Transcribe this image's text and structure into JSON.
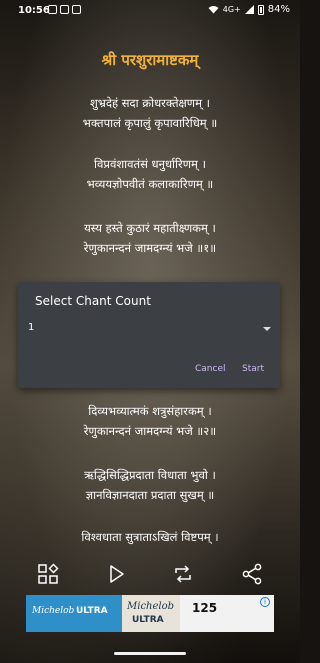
{
  "status_bar": {
    "time": "10:56",
    "network": "4G+",
    "battery": "84%"
  },
  "title": "श्री परशुरामाष्टकम्",
  "verses": [
    {
      "line1": "शुभ्रदेहं सदा क्रोधरक्तेक्षणम् ।",
      "line2": "भक्तपालं कृपालुं कृपावारिधिम् ॥"
    },
    {
      "line1": "विप्रवंशावतंसं धनुर्धारिणम् ।",
      "line2": "भव्ययज्ञोपवीतं कलाकारिणम् ॥"
    },
    {
      "line1": "यस्य हस्ते कुठारं महातीक्ष्णकम् ।",
      "line2": "रेणुकानन्दनं जामदग्न्यं भजे ॥१॥"
    },
    {
      "line1": "दिव्यभव्यात्मकं शत्रुसंहारकम् ।",
      "line2": "रेणुकानन्दनं जामदग्न्यं भजे ॥२॥"
    },
    {
      "line1": "ऋद्धिसिद्धिप्रदाता विधाता भुवो ।",
      "line2": "ज्ञानविज्ञानदाता प्रदाता सुखम् ॥"
    },
    {
      "line1": "विश्वधाता सुत्राताऽखिलं विष्टपम् ।",
      "line2": ""
    }
  ],
  "dialog": {
    "title": "Select Chant Count",
    "selected_value": "1",
    "cancel_label": "Cancel",
    "start_label": "Start"
  },
  "toolbar": {
    "icons": [
      "grid-icon",
      "play-icon",
      "repeat-icon",
      "share-icon"
    ]
  },
  "ad": {
    "brand": "Michelob",
    "ultra": "ULTRA",
    "logo_text": "125"
  },
  "colors": {
    "title": "#f2b23a",
    "dialog_bg": "#3c3f44",
    "button_text": "#d1b8f5"
  }
}
